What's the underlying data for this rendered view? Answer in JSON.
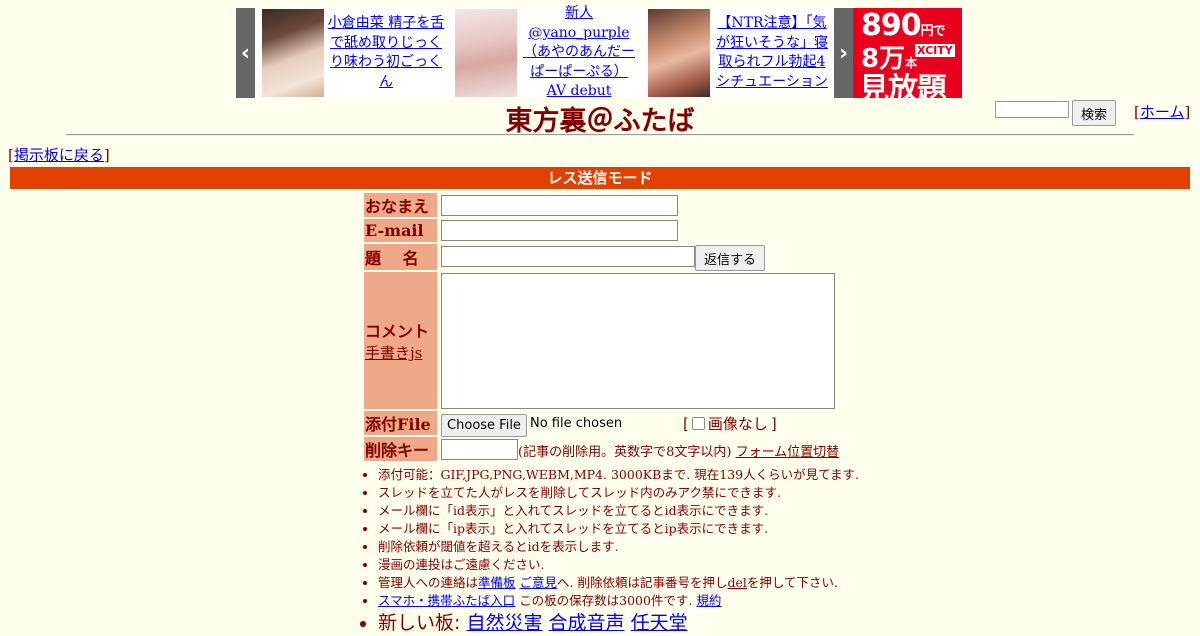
{
  "ad": {
    "prev": "‹",
    "next": "›",
    "items": [
      {
        "title": "小倉由菜 精子を舌で舐め取りじっくり味わう初ごっくん"
      },
      {
        "title": "新人 @yano_purple（あやのあんだーぱーぱーぷる） AV debut"
      },
      {
        "title": "【NTR注意】「気が狂いそうな」寝取られフル勃起4シチュエーション"
      }
    ],
    "promo": {
      "line1": "890",
      "unit1": "円で",
      "line2": "8万",
      "unit2": "本",
      "brand": "XCITY",
      "line3": "見放題"
    }
  },
  "header": {
    "title": "東方裏＠ふたば",
    "search_button": "検索",
    "home_open": "[",
    "home_link": "ホーム",
    "home_close": "]"
  },
  "nav": {
    "back_open": "[",
    "back_link": "掲示板に戻る",
    "back_close": "]"
  },
  "mode_bar": "レス送信モード",
  "form": {
    "name_label": "おなまえ",
    "email_label": "E-mail",
    "subject_label": "題　 名",
    "submit_label": "返信する",
    "comment_label": "コメント",
    "handwriting_link": "手書きjs",
    "file_label": "添付File",
    "file_button": "Choose File",
    "file_status": "No file chosen",
    "no_image_open": "[",
    "no_image_label": "画像なし",
    "no_image_close": "]",
    "delkey_label": "削除キー",
    "delkey_note": "(記事の削除用。英数字で8文字以内)",
    "form_toggle": "フォーム位置切替"
  },
  "notes": {
    "n1": "添付可能：GIF,JPG,PNG,WEBM,MP4. 3000KBまで. 現在139人くらいが見てます.",
    "n2": "スレッドを立てた人がレスを削除してスレッド内のみアク禁にできます.",
    "n3": "メール欄に「id表示」と入れてスレッドを立てるとid表示にできます.",
    "n4": "メール欄に「ip表示」と入れてスレッドを立てるとip表示にできます.",
    "n5": "削除依頼が閾値を超えるとidを表示します.",
    "n6": "漫画の連投はご遠慮ください.",
    "n7_a": "管理人への連絡は",
    "n7_link1": "準備板",
    "n7_link2": "ご意見",
    "n7_b": "へ. 削除依頼は記事番号を押し",
    "n7_link3": "del",
    "n7_c": "を押して下さい.",
    "n8_link1": "スマホ・携帯ふたば入口",
    "n8_text": " この板の保存数は3000件です.",
    "n8_link2": "規約",
    "n9_label": "新しい板: ",
    "n9_boards": [
      "自然災害",
      "合成音声",
      "任天堂"
    ]
  }
}
